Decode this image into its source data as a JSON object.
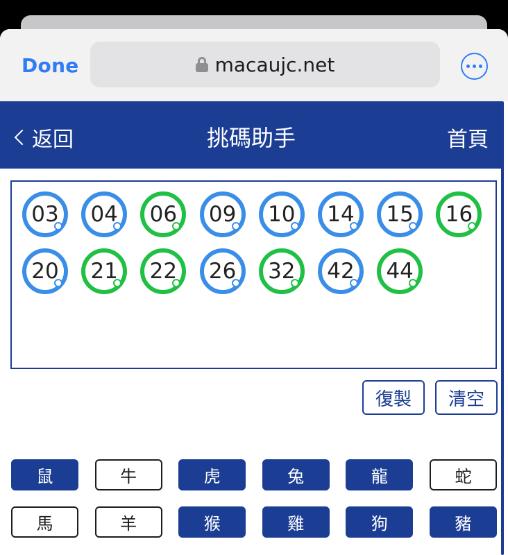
{
  "browser": {
    "done_label": "Done",
    "url": "macaujc.net"
  },
  "header": {
    "back_label": "返回",
    "title": "挑碼助手",
    "home_label": "首頁",
    "color": "#1b3d94"
  },
  "balls": [
    {
      "num": "03",
      "color": "blue"
    },
    {
      "num": "04",
      "color": "blue"
    },
    {
      "num": "06",
      "color": "green"
    },
    {
      "num": "09",
      "color": "blue"
    },
    {
      "num": "10",
      "color": "blue"
    },
    {
      "num": "14",
      "color": "blue"
    },
    {
      "num": "15",
      "color": "blue"
    },
    {
      "num": "16",
      "color": "green"
    },
    {
      "num": "20",
      "color": "blue"
    },
    {
      "num": "21",
      "color": "green"
    },
    {
      "num": "22",
      "color": "green"
    },
    {
      "num": "26",
      "color": "blue"
    },
    {
      "num": "32",
      "color": "green"
    },
    {
      "num": "42",
      "color": "blue"
    },
    {
      "num": "44",
      "color": "green"
    }
  ],
  "actions": {
    "copy_label": "復製",
    "clear_label": "清空"
  },
  "zodiacs": [
    {
      "label": "鼠",
      "selected": true
    },
    {
      "label": "牛",
      "selected": false
    },
    {
      "label": "虎",
      "selected": true
    },
    {
      "label": "兔",
      "selected": true
    },
    {
      "label": "龍",
      "selected": true
    },
    {
      "label": "蛇",
      "selected": false
    },
    {
      "label": "馬",
      "selected": false
    },
    {
      "label": "羊",
      "selected": false
    },
    {
      "label": "猴",
      "selected": true
    },
    {
      "label": "雞",
      "selected": true
    },
    {
      "label": "狗",
      "selected": true
    },
    {
      "label": "豬",
      "selected": true
    }
  ]
}
